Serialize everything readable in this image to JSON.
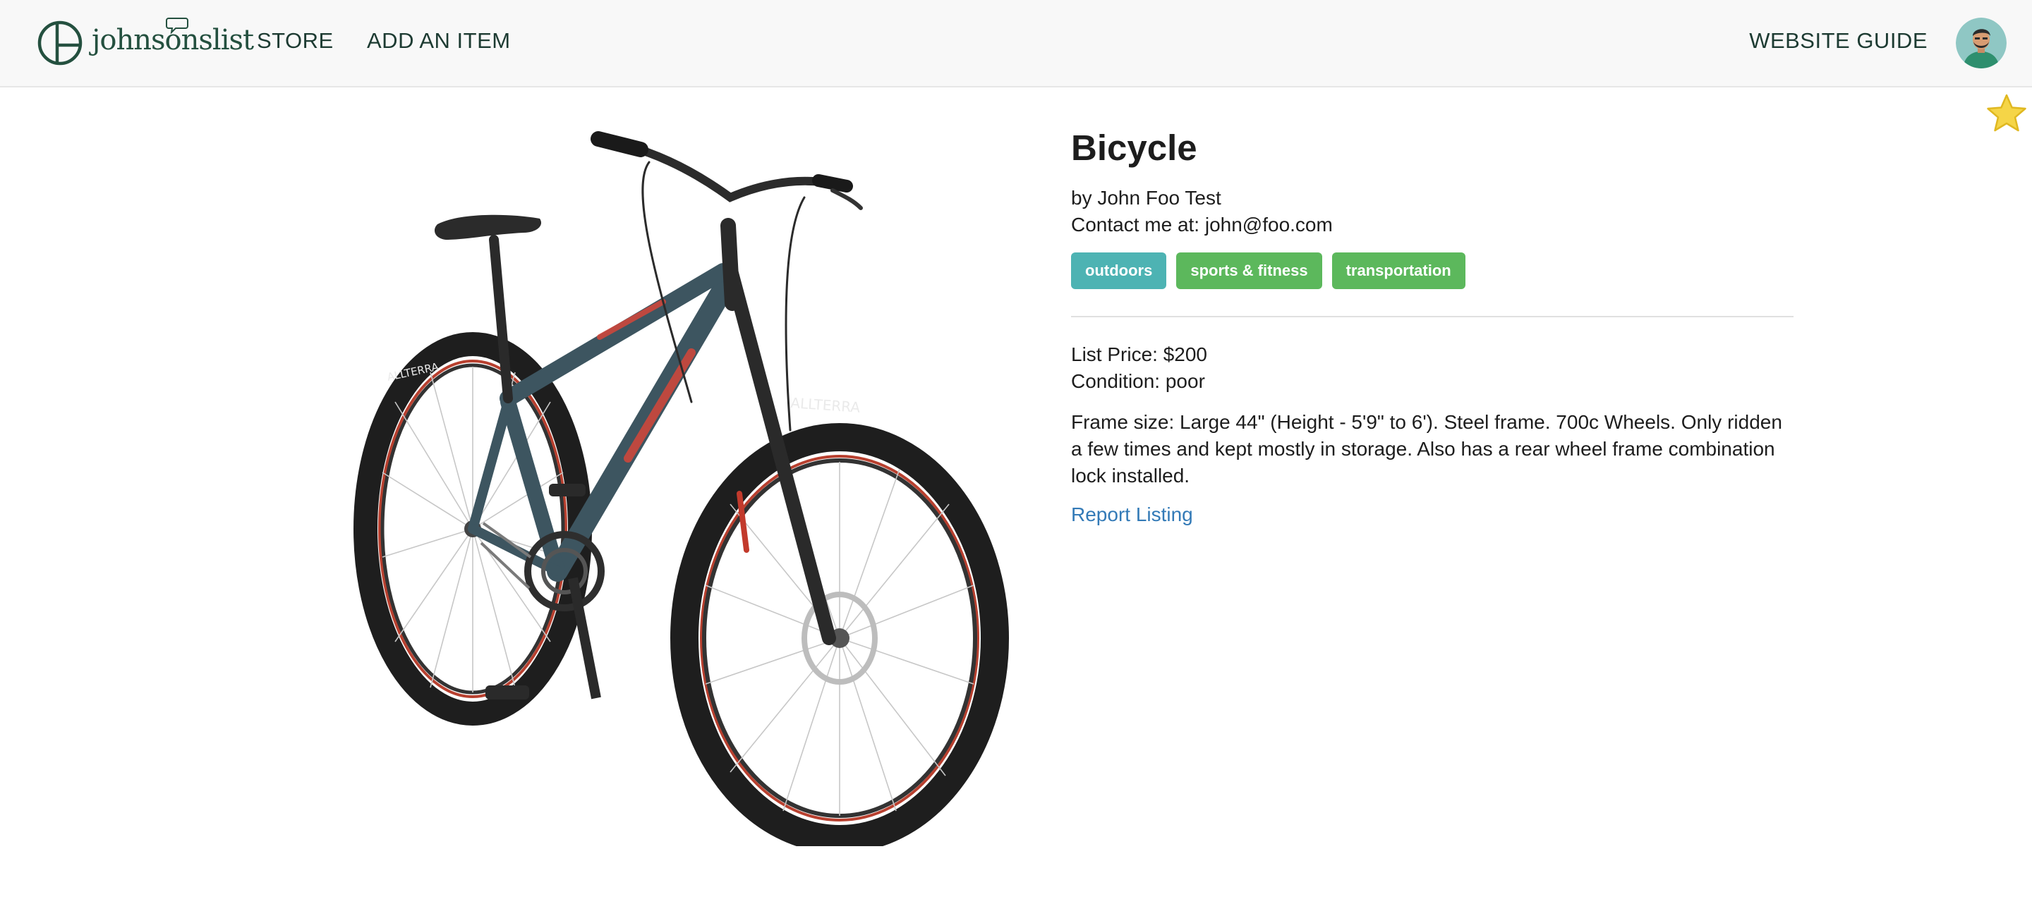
{
  "header": {
    "brand": "johnsonslist",
    "nav": {
      "store": "STORE",
      "add_item": "ADD AN ITEM",
      "guide": "WEBSITE GUIDE"
    },
    "brand_color": "#24503f"
  },
  "listing": {
    "title": "Bicycle",
    "author": "by John Foo Test",
    "contact": "Contact me at: john@foo.com",
    "tags": [
      "outdoors",
      "sports & fitness",
      "transportation"
    ],
    "list_price": "List Price: $200",
    "condition": "Condition: poor",
    "description": "Frame size: Large 44\" (Height - 5'9\" to 6'). Steel frame. 700c Wheels. Only ridden a few times and kept mostly in storage. Also has a rear wheel frame combination lock installed.",
    "report_label": "Report Listing",
    "tire_brand": "ALLTERRA"
  },
  "colors": {
    "tag_teal": "#4db3b3",
    "tag_green": "#5cb85c",
    "link": "#337ab7",
    "star": "#f5d547"
  },
  "icons": {
    "favorite": "star-icon",
    "logo": "logo-icon",
    "profile": "avatar"
  }
}
